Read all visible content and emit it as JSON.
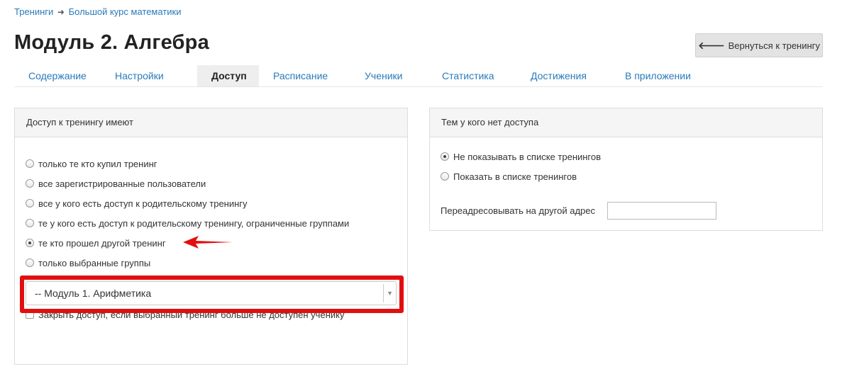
{
  "breadcrumb": {
    "items": [
      "Тренинги",
      "Большой курс математики"
    ],
    "separator": "➜"
  },
  "page": {
    "title": "Модуль 2. Алгебра",
    "back_button": {
      "arrow": "🡐",
      "label": "Вернуться к тренингу"
    }
  },
  "tabs": [
    {
      "label": "Содержание"
    },
    {
      "label": "Настройки"
    },
    {
      "label": "Доступ",
      "active": true
    },
    {
      "label": "Расписание"
    },
    {
      "label": "Ученики"
    },
    {
      "label": "Статистика"
    },
    {
      "label": "Достижения"
    },
    {
      "label": "В приложении"
    }
  ],
  "access_panel": {
    "title": "Доступ к тренингу имеют",
    "options": [
      {
        "label": "только те кто купил тренинг",
        "checked": false
      },
      {
        "label": "все зарегистрированные пользователи",
        "checked": false
      },
      {
        "label": "все у кого есть доступ к родительскому тренингу",
        "checked": false
      },
      {
        "label": "те у кого есть доступ к родительскому тренингу, ограниченные группами",
        "checked": false
      },
      {
        "label": "те кто прошел другой тренинг",
        "checked": true
      },
      {
        "label": "только выбранные группы",
        "checked": false
      }
    ],
    "training_select": {
      "value": "-- Модуль 1. Арифметика",
      "caret": "▼"
    },
    "close_access_checkbox": {
      "label": "Закрыть доступ, если выбранный тренинг больше не доступен ученику",
      "checked": false
    }
  },
  "no_access_panel": {
    "title": "Тем у кого нет доступа",
    "options": [
      {
        "label": "Не показывать в списке тренингов",
        "checked": true
      },
      {
        "label": "Показать в списке тренингов",
        "checked": false
      }
    ],
    "redirect": {
      "label": "Переадресовывать на другой адрес",
      "value": "",
      "placeholder": ""
    }
  },
  "annotations": {
    "highlight_color": "#e10f0f"
  },
  "colors": {
    "link": "#2a7ab8",
    "panel_header_bg": "#f5f5f5",
    "active_tab_bg": "#eeeeee"
  }
}
